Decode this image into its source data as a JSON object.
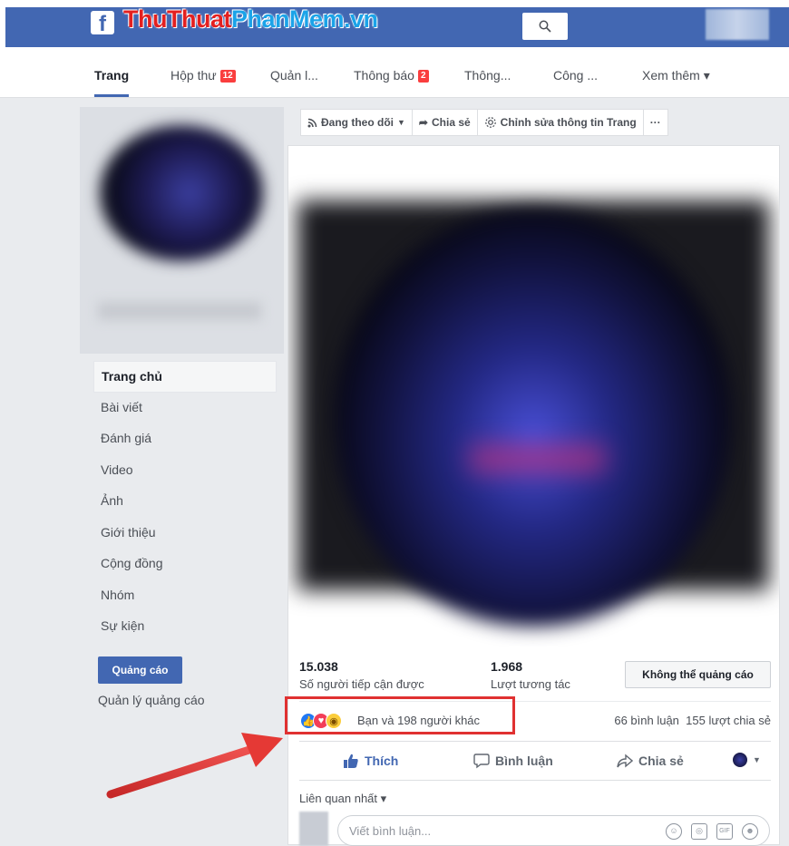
{
  "watermark": {
    "part1": "ThuThuat",
    "part2": "PhanMem",
    "part3": ".vn"
  },
  "topbar": {
    "logo": "f",
    "search_icon": "search-icon"
  },
  "nav": {
    "items": [
      {
        "label": "Trang"
      },
      {
        "label": "Hộp thư",
        "badge": "12"
      },
      {
        "label": "Quản l..."
      },
      {
        "label": "Thông báo",
        "badge": "2"
      },
      {
        "label": "Thông..."
      },
      {
        "label": "Công ..."
      },
      {
        "label": "Xem thêm ▾"
      }
    ]
  },
  "sidebar": {
    "links": [
      "Trang chủ",
      "Bài viết",
      "Đánh giá",
      "Video",
      "Ảnh",
      "Giới thiệu",
      "Cộng đồng",
      "Nhóm",
      "Sự kiện"
    ],
    "ads_button": "Quảng cáo",
    "ads_manage": "Quản lý quảng cáo"
  },
  "actions": {
    "follow": "Đang theo dõi",
    "share": "Chia sẻ",
    "edit": "Chỉnh sửa thông tin Trang",
    "more": "···"
  },
  "post": {
    "reach_value": "15.038",
    "reach_label": "Số người tiếp cận được",
    "engage_value": "1.968",
    "engage_label": "Lượt tương tác",
    "no_ads": "Không thể quảng cáo",
    "reaction_text": "Bạn và 198 người khác",
    "comments": "66 bình luận",
    "shares": "155 lượt chia sẻ",
    "like": "Thích",
    "comment": "Bình luận",
    "share": "Chia sẻ",
    "relevance": "Liên quan nhất ▾",
    "comment_placeholder": "Viết bình luận..."
  },
  "colors": {
    "brand": "#4267b2",
    "highlight": "#e03131",
    "arrow": "#e53935"
  }
}
